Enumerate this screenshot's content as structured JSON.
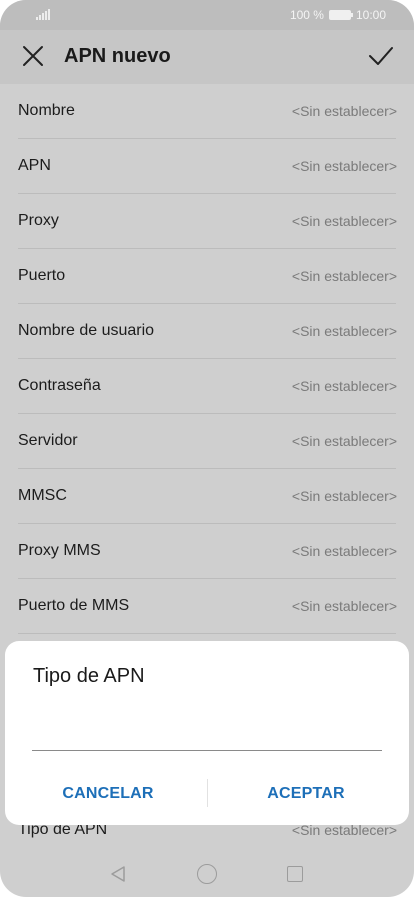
{
  "status": {
    "battery_text": "100 %",
    "time": "10:00"
  },
  "appbar": {
    "title": "APN nuevo"
  },
  "fields": [
    {
      "label": "Nombre",
      "value": "<Sin establecer>"
    },
    {
      "label": "APN",
      "value": "<Sin establecer>"
    },
    {
      "label": "Proxy",
      "value": "<Sin establecer>"
    },
    {
      "label": "Puerto",
      "value": "<Sin establecer>"
    },
    {
      "label": "Nombre de usuario",
      "value": "<Sin establecer>"
    },
    {
      "label": "Contraseña",
      "value": "<Sin establecer>"
    },
    {
      "label": "Servidor",
      "value": "<Sin establecer>"
    },
    {
      "label": "MMSC",
      "value": "<Sin establecer>"
    },
    {
      "label": "Proxy MMS",
      "value": "<Sin establecer>"
    },
    {
      "label": "Puerto de MMS",
      "value": "<Sin establecer>"
    }
  ],
  "peek_field": {
    "label": "Tipo de APN",
    "value": "<Sin establecer>"
  },
  "dialog": {
    "title": "Tipo de APN",
    "input_value": "",
    "cancel_label": "CANCELAR",
    "accept_label": "ACEPTAR"
  },
  "colors": {
    "accent": "#1d6fb8",
    "overlay": "#cfcfcf",
    "dialog_bg": "#ffffff"
  }
}
